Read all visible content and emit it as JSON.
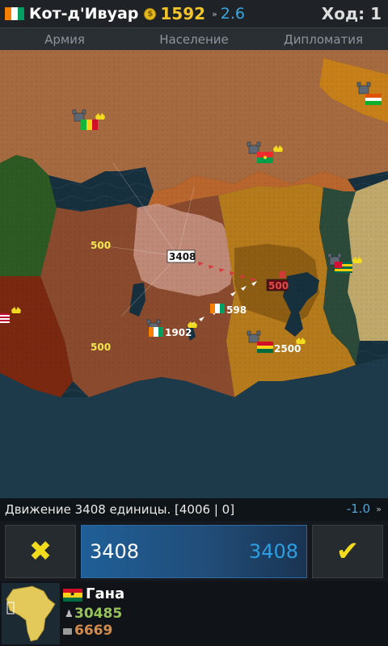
{
  "header": {
    "country": "Кот-д'Ивуар",
    "gold": "1592",
    "income": "2.6",
    "turn": "Ход: 1"
  },
  "tabs": [
    "Армия",
    "Население",
    "Дипломатия"
  ],
  "map": {
    "labels": [
      {
        "text": "500",
        "color": "#f2e64e"
      },
      {
        "text": "3408",
        "color": "#111111"
      },
      {
        "text": "500",
        "color": "#f2e64e"
      },
      {
        "text": "1902",
        "color": "#ffffff"
      },
      {
        "text": "598",
        "color": "#ffffff"
      },
      {
        "text": "500",
        "color": "#e24b4b"
      },
      {
        "text": "2500",
        "color": "#ffffff"
      }
    ]
  },
  "status": {
    "text": "Движение 3408 единицы. [4006 | 0]",
    "value": "-1.0"
  },
  "controls": {
    "amount": "3408",
    "amount_max": "3408"
  },
  "info": {
    "country": "Гана",
    "population": "30485",
    "gold": "6669"
  },
  "colors": {
    "cotedivoire": "#8a4a2e",
    "ghana": "#b47a1c",
    "burkina": "#b8662e",
    "liberia": "#7a2810",
    "guinea": "#2d5a22",
    "togo": "#2c4a3a",
    "sea": "#16303e",
    "accent_yellow": "#f2da1d",
    "accent_blue": "#2e9ee0"
  }
}
